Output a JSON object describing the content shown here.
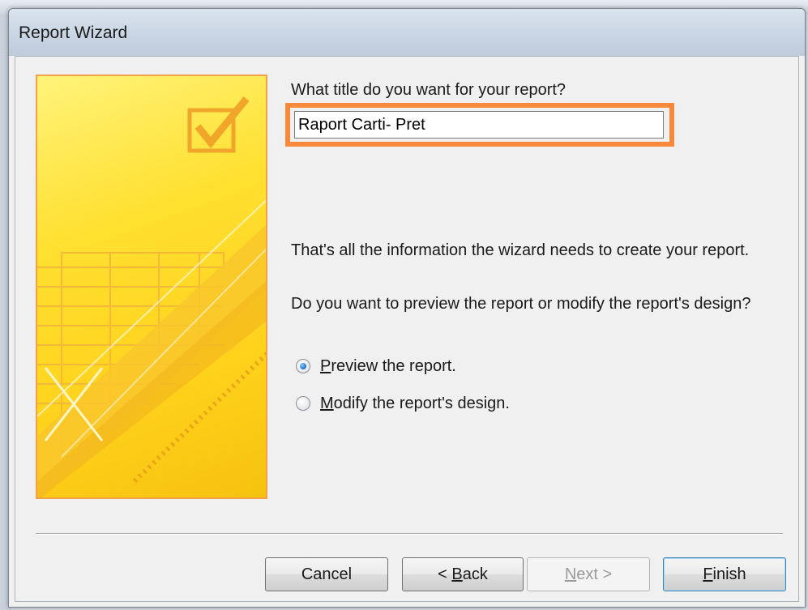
{
  "window": {
    "title": "Report Wizard"
  },
  "form": {
    "title_prompt": "What title do you want for your report?",
    "title_value": "Raport Carti- Pret",
    "info_text": "That's all the information the wizard needs to create your report.",
    "question_text": "Do you want to preview the report or modify the report's design?",
    "options": [
      {
        "mnemonic": "P",
        "rest": "review the report.",
        "selected": true
      },
      {
        "mnemonic": "M",
        "rest": "odify the report's design.",
        "selected": false
      }
    ]
  },
  "buttons": {
    "cancel": "Cancel",
    "back_prefix": "< ",
    "back_mnemonic": "B",
    "back_rest": "ack",
    "next_mnemonic": "N",
    "next_rest": "ext >",
    "finish_mnemonic": "F",
    "finish_rest": "inish"
  },
  "colors": {
    "highlight": "#f7893a",
    "art_yellow": "#ffd21c"
  },
  "icons": {
    "wizard_art": "checkmark-report-illustration"
  }
}
